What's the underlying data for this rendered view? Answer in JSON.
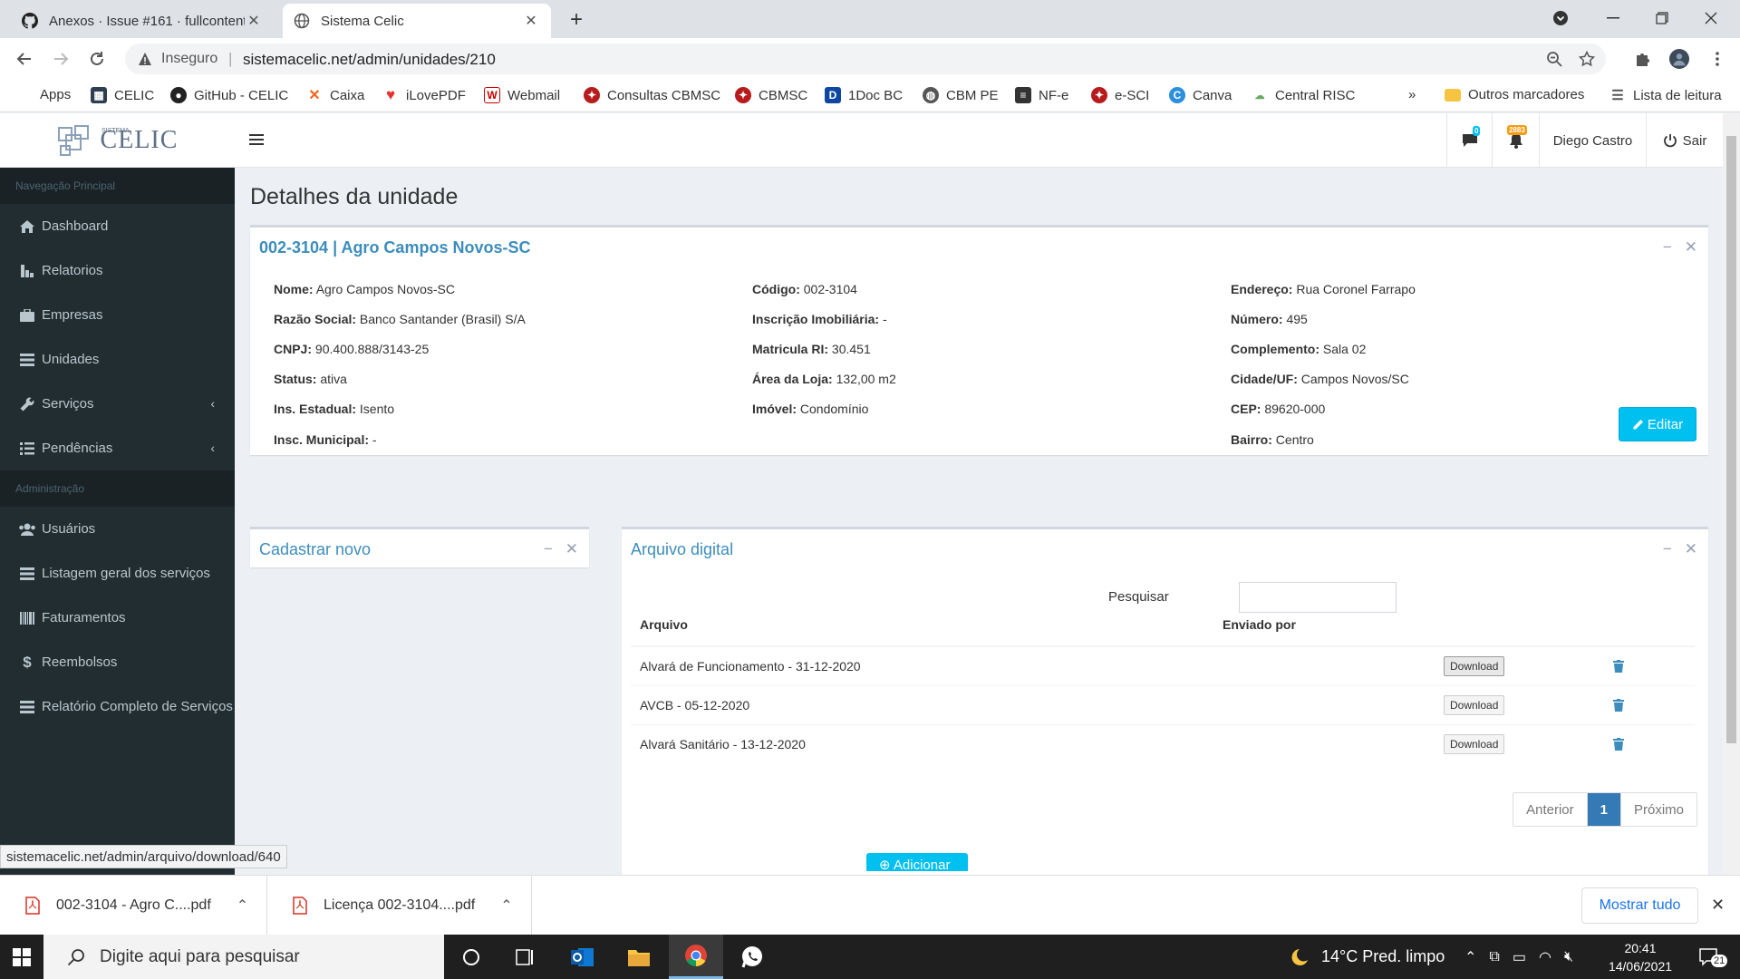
{
  "browser": {
    "tabs": [
      {
        "title": "Anexos · Issue #161 · fullcontent/"
      },
      {
        "title": "Sistema Celic"
      }
    ],
    "security_label": "Inseguro",
    "url": "sistemacelic.net/admin/unidades/210",
    "bookmarks": [
      {
        "label": "Apps",
        "icon": "apps-grid-icon"
      },
      {
        "label": "CELIC",
        "icon": "celic-icon"
      },
      {
        "label": "GitHub - CELIC",
        "icon": "github-icon"
      },
      {
        "label": "Caixa",
        "icon": "caixa-icon"
      },
      {
        "label": "iLovePDF",
        "icon": "ilovepdf-icon"
      },
      {
        "label": "Webmail",
        "icon": "webmail-icon"
      },
      {
        "label": "Consultas CBMSC",
        "icon": "cbmsc-icon"
      },
      {
        "label": "CBMSC",
        "icon": "cbmsc-icon"
      },
      {
        "label": "1Doc BC",
        "icon": "1doc-icon"
      },
      {
        "label": "CBM PE",
        "icon": "globe-icon"
      },
      {
        "label": "NF-e",
        "icon": "nfe-icon"
      },
      {
        "label": "e-SCI",
        "icon": "esci-icon"
      },
      {
        "label": "Canva",
        "icon": "canva-icon"
      },
      {
        "label": "Central RISC",
        "icon": "risc-icon"
      }
    ],
    "bookmarks_overflow": "»",
    "other_bookmarks": "Outros marcadores",
    "reading_list": "Lista de leitura",
    "status_url": "sistemacelic.net/admin/arquivo/download/640"
  },
  "app": {
    "logo_small": "SISTEMA",
    "logo_text": "CELIC",
    "header": {
      "messages_count": "0",
      "notifications_count": "2883",
      "user_name": "Diego Castro",
      "logout_label": "Sair"
    },
    "sidebar": {
      "section_main": "Navegação Principal",
      "main_items": [
        {
          "label": "Dashboard",
          "icon": "home-icon"
        },
        {
          "label": "Relatorios",
          "icon": "report-icon"
        },
        {
          "label": "Empresas",
          "icon": "briefcase-icon"
        },
        {
          "label": "Unidades",
          "icon": "list-icon"
        },
        {
          "label": "Serviços",
          "icon": "wrench-icon"
        },
        {
          "label": "Pendências",
          "icon": "tasks-icon"
        }
      ],
      "section_admin": "Administração",
      "admin_items": [
        {
          "label": "Usuários",
          "icon": "users-icon"
        },
        {
          "label": "Listagem geral dos serviços",
          "icon": "list-icon"
        },
        {
          "label": "Faturamentos",
          "icon": "barcode-icon"
        },
        {
          "label": "Reembolsos",
          "icon": "dollar-icon"
        },
        {
          "label": "Relatório Completo de Serviços",
          "icon": "list-icon"
        }
      ]
    },
    "page_title": "Detalhes da unidade",
    "unit": {
      "title": "002-3104 | Agro Campos Novos-SC",
      "col1": [
        {
          "label": "Nome:",
          "value": "Agro Campos Novos-SC"
        },
        {
          "label": "Razão Social:",
          "value": "Banco Santander (Brasil) S/A"
        },
        {
          "label": "CNPJ:",
          "value": "90.400.888/3143-25"
        },
        {
          "label": "Status:",
          "value": "ativa"
        },
        {
          "label": "Ins. Estadual:",
          "value": "Isento"
        },
        {
          "label": "Insc. Municipal:",
          "value": "-"
        }
      ],
      "col2": [
        {
          "label": "Código:",
          "value": "002-3104"
        },
        {
          "label": "Inscrição Imobiliária:",
          "value": "-"
        },
        {
          "label": "Matricula RI:",
          "value": "30.451"
        },
        {
          "label": "Área da Loja:",
          "value": "132,00 m2"
        },
        {
          "label": "Imóvel:",
          "value": "Condomínio"
        }
      ],
      "col3": [
        {
          "label": "Endereço:",
          "value": "Rua Coronel Farrapo"
        },
        {
          "label": "Número:",
          "value": "495"
        },
        {
          "label": "Complemento:",
          "value": "Sala 02"
        },
        {
          "label": "Cidade/UF:",
          "value": "Campos Novos/SC"
        },
        {
          "label": "CEP:",
          "value": "89620-000"
        },
        {
          "label": "Bairro:",
          "value": "Centro"
        }
      ],
      "edit_label": "Editar"
    },
    "new_box": {
      "title": "Cadastrar novo"
    },
    "archive": {
      "title": "Arquivo digital",
      "search_label": "Pesquisar",
      "search_value": "",
      "columns": [
        "Arquivo",
        "Enviado por"
      ],
      "rows": [
        {
          "file": "Alvará de Funcionamento - 31-12-2020",
          "sent_by": "",
          "action": "Download"
        },
        {
          "file": "AVCB - 05-12-2020",
          "sent_by": "",
          "action": "Download"
        },
        {
          "file": "Alvará Sanitário - 13-12-2020",
          "sent_by": "",
          "action": "Download"
        }
      ],
      "pager": {
        "prev": "Anterior",
        "current": "1",
        "next": "Próximo"
      },
      "add_label": "Adicionar"
    }
  },
  "downloads": {
    "items": [
      {
        "name": "002-3104 - Agro C....pdf"
      },
      {
        "name": "Licença 002-3104....pdf"
      }
    ],
    "show_all": "Mostrar tudo"
  },
  "taskbar": {
    "search_placeholder": "Digite aqui para pesquisar",
    "weather": "14°C  Pred. limpo",
    "time": "20:41",
    "date": "14/06/2021",
    "notifications": "21"
  },
  "colors": {
    "sidebar_bg": "#222d32",
    "link_blue": "#3c8dbc",
    "edit_button": "#00c0ef",
    "pager_active": "#337ab7",
    "delete_icon": "#3c8dbc"
  }
}
